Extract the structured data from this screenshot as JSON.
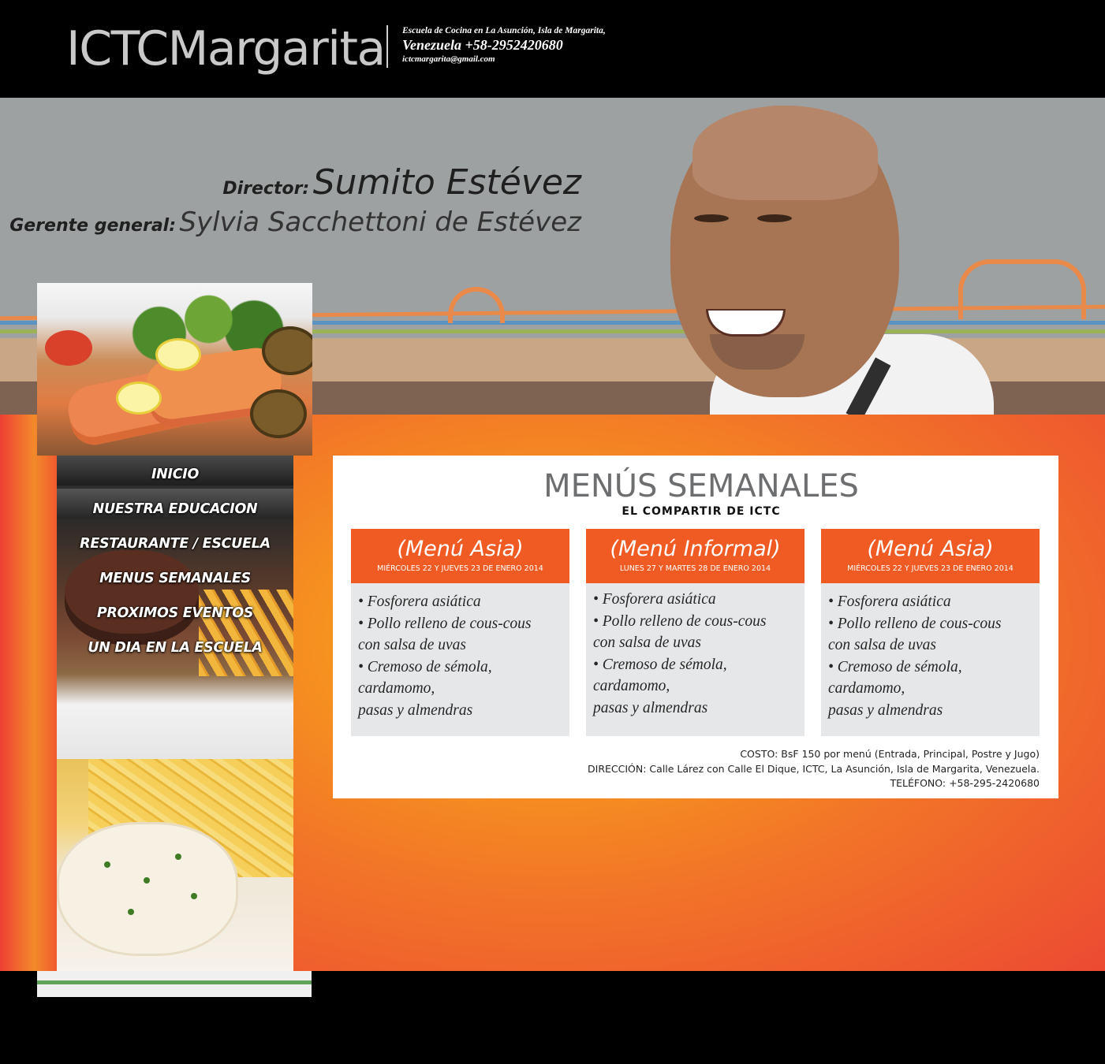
{
  "header": {
    "logo": "ICTCMargarita",
    "line1": "Escuela de Cocina en La Asunción, Isla de Margarita,",
    "line2": "Venezuela +58-2952420680",
    "line3": "ictcmargarita@gmail.com"
  },
  "hero": {
    "director_label": "Director:",
    "director_name": "Sumito Estévez",
    "manager_label": "Gerente general:",
    "manager_name": "Sylvia Sacchettoni de Estévez"
  },
  "nav": {
    "items": [
      {
        "label": "INICIO"
      },
      {
        "label": "NUESTRA EDUCACION"
      },
      {
        "label": "RESTAURANTE / ESCUELA"
      },
      {
        "label": "MENUS SEMANALES"
      },
      {
        "label": "PROXIMOS EVENTOS"
      },
      {
        "label": "UN DIA EN LA ESCUELA"
      }
    ]
  },
  "content": {
    "title": "MENÚS SEMANALES",
    "subtitle": "EL COMPARTIR DE ICTC",
    "menus": [
      {
        "title": "(Menú Asia)",
        "date": "MIÉRCOLES 22 Y JUEVES 23 DE ENERO 2014",
        "items": [
          "• Fosforera asiática",
          "• Pollo relleno de cous-cous",
          "con salsa de uvas",
          "• Cremoso de sémola, cardamomo,",
          "pasas y almendras"
        ]
      },
      {
        "title": "(Menú Informal)",
        "date": "LUNES 27 Y MARTES 28 DE ENERO 2014",
        "items": [
          "• Fosforera asiática",
          "• Pollo relleno de cous-cous",
          "con salsa de uvas",
          "• Cremoso de sémola, cardamomo,",
          "pasas y almendras"
        ]
      },
      {
        "title": "(Menú Asia)",
        "date": "MIÉRCOLES 22 Y JUEVES 23 DE ENERO 2014",
        "items": [
          "• Fosforera asiática",
          "• Pollo relleno de cous-cous",
          "con salsa de uvas",
          "• Cremoso de sémola, cardamomo,",
          "pasas y almendras"
        ]
      }
    ],
    "footer": {
      "cost": "COSTO: BsF 150 por menú (Entrada, Principal, Postre y Jugo)",
      "address": "DIRECCIÓN: Calle Lárez con Calle El Dique, ICTC, La Asunción, Isla de Margarita, Venezuela.",
      "phone": "TELÉFONO: +58-295-2420680"
    }
  },
  "colors": {
    "header_bg": "#000000",
    "hero_bg": "#9ea1a1",
    "accent_orange": "#f05a23",
    "menu_box_bg": "#e6e7e8",
    "title_gray": "#6d6e70"
  }
}
